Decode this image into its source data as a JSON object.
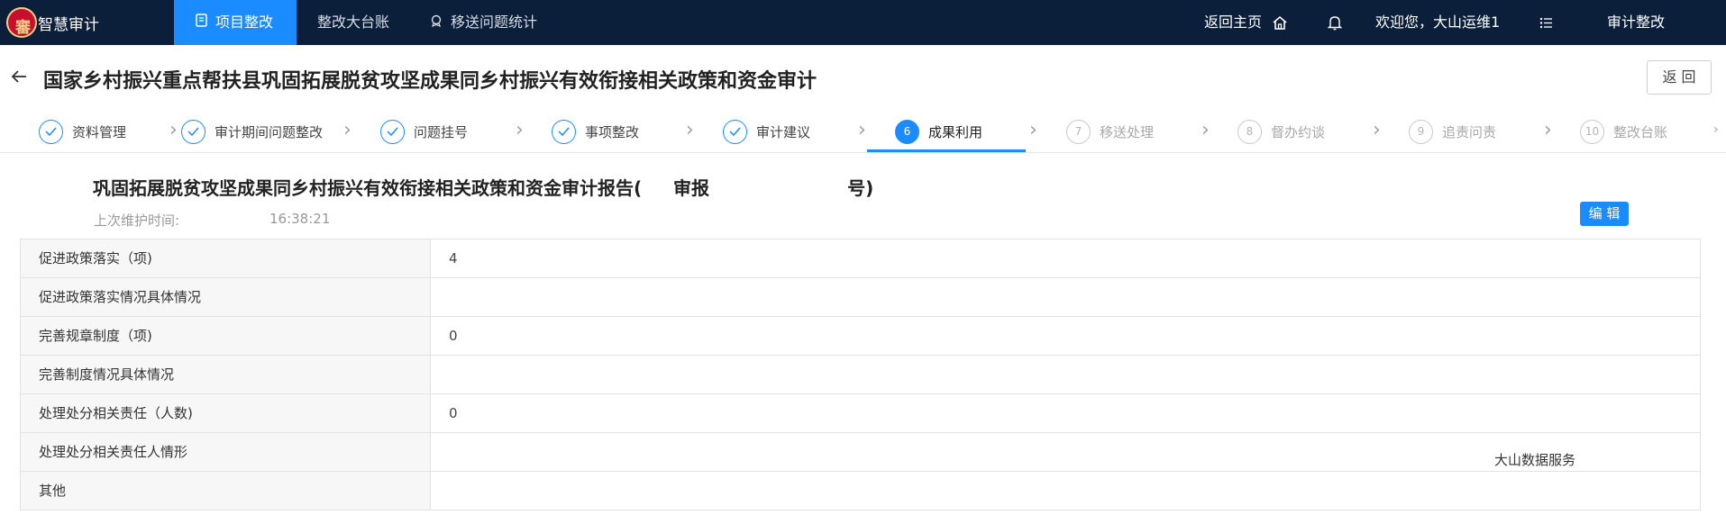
{
  "topbar": {
    "app_title": "智慧审计",
    "logo_glyph": "審",
    "nav": [
      {
        "label": "项目整改",
        "icon": "document-icon"
      },
      {
        "label": "整改大台账",
        "icon": ""
      },
      {
        "label": "移送问题统计",
        "icon": "badge-icon"
      }
    ],
    "home_label": "返回主页",
    "welcome": "欢迎您，大山运维1",
    "module_label": "审计整改"
  },
  "page": {
    "title": "国家乡村振兴重点帮扶县巩固拓展脱贫攻坚成果同乡村振兴有效衔接相关政策和资金审计",
    "return_label": "返 回"
  },
  "steps": [
    {
      "index": "1",
      "label": "资料管理",
      "state": "done"
    },
    {
      "index": "2",
      "label": "审计期间问题整改",
      "state": "done"
    },
    {
      "index": "3",
      "label": "问题挂号",
      "state": "done"
    },
    {
      "index": "4",
      "label": "事项整改",
      "state": "done"
    },
    {
      "index": "5",
      "label": "审计建议",
      "state": "done"
    },
    {
      "index": "6",
      "label": "成果利用",
      "state": "active"
    },
    {
      "index": "7",
      "label": "移送处理",
      "state": "todo"
    },
    {
      "index": "8",
      "label": "督办约谈",
      "state": "todo"
    },
    {
      "index": "9",
      "label": "追责问责",
      "state": "todo"
    },
    {
      "index": "10",
      "label": "整改台账",
      "state": "todo"
    }
  ],
  "report": {
    "title": "巩固拓展脱贫攻坚成果同乡村振兴有效衔接相关政策和资金审计报告(     审报                      号)",
    "maint_label": "上次维护时间:",
    "maint_time": "16:38:21",
    "edit_label": "编 辑"
  },
  "table": [
    {
      "key": "促进政策落实（项)",
      "value": "4"
    },
    {
      "key": "促进政策落实情况具体情况",
      "value": ""
    },
    {
      "key": "完善规章制度（项)",
      "value": "0"
    },
    {
      "key": "完善制度情况具体情况",
      "value": ""
    },
    {
      "key": "处理处分相关责任（人数)",
      "value": "0"
    },
    {
      "key": "处理处分相关责任人情形",
      "value": ""
    },
    {
      "key": "其他",
      "value": ""
    }
  ],
  "watermark": "大山数据服务",
  "colors": {
    "topbar": "#0b1e3a",
    "accent": "#1a8cff"
  }
}
